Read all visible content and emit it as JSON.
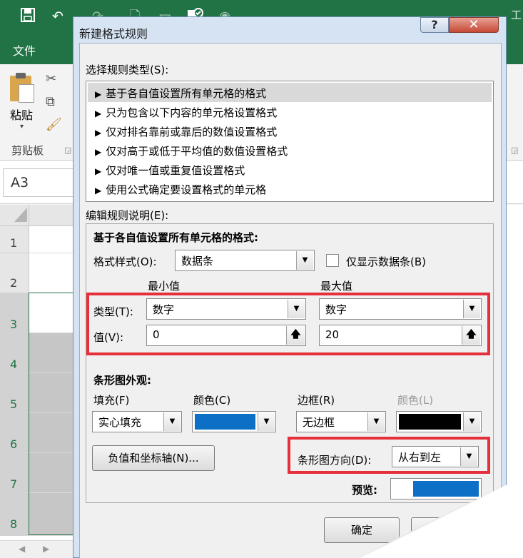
{
  "excel": {
    "qat_icons": [
      "save-icon",
      "undo-icon",
      "redo-icon",
      "print-preview-icon",
      "clipboard-icon",
      "spellcheck-icon",
      "camera-icon"
    ],
    "title_right": "工",
    "tab_file": "文件",
    "paste_label": "粘贴",
    "clipboard_group": "剪贴板",
    "name_box": "A3",
    "row_numbers": [
      "1",
      "2",
      "3",
      "4",
      "5",
      "6",
      "7",
      "8"
    ]
  },
  "dialog": {
    "title": "新建格式规则",
    "help_label": "?",
    "close_label": "✕",
    "select_rule_type_label": "选择规则类型(S):",
    "rule_types": [
      "基于各自值设置所有单元格的格式",
      "只为包含以下内容的单元格设置格式",
      "仅对排名靠前或靠后的数值设置格式",
      "仅对高于或低于平均值的数值设置格式",
      "仅对唯一值或重复值设置格式",
      "使用公式确定要设置格式的单元格"
    ],
    "selected_rule_index": 0,
    "edit_rule_label": "编辑规则说明(E):",
    "edit": {
      "heading": "基于各自值设置所有单元格的格式:",
      "format_style_label": "格式样式(O):",
      "format_style_value": "数据条",
      "show_bar_only_label": "仅显示数据条(B)",
      "show_bar_only_checked": false,
      "min_header": "最小值",
      "max_header": "最大值",
      "type_label": "类型(T):",
      "min_type": "数字",
      "max_type": "数字",
      "value_label": "值(V):",
      "min_value": "0",
      "max_value": "20",
      "bar_appearance_heading": "条形图外观:",
      "fill_label": "填充(F)",
      "fill_value": "实心填充",
      "fill_color_label": "颜色(C)",
      "fill_color": "#0d70c6",
      "border_label": "边框(R)",
      "border_value": "无边框",
      "border_color_label": "颜色(L)",
      "border_color": "#000000",
      "negative_axis_button": "负值和坐标轴(N)...",
      "bar_direction_label": "条形图方向(D):",
      "bar_direction_value": "从右到左",
      "preview_label": "预览:",
      "preview_bar_color": "#0d70c6"
    },
    "ok_button": "确定",
    "highlight_color": "#e5303b"
  }
}
